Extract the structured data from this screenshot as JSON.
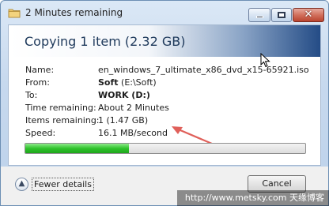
{
  "window": {
    "title": "2 Minutes remaining",
    "controls": {
      "close_label": "✕"
    }
  },
  "dialog": {
    "heading": "Copying 1 item (2.32 GB)",
    "details": [
      {
        "label": "Name:",
        "value": "en_windows_7_ultimate_x86_dvd_x15-65921.iso",
        "bold_part": ""
      },
      {
        "label": "From:",
        "value": "(E:\\Soft)",
        "bold_part": "Soft"
      },
      {
        "label": "To:",
        "value": "",
        "bold_part": "WORK (D:)"
      },
      {
        "label": "Time remaining:",
        "value": "About 2 Minutes",
        "bold_part": ""
      },
      {
        "label": "Items remaining:",
        "value": "1 (1.47 GB)",
        "bold_part": ""
      },
      {
        "label": "Speed:",
        "value": "16.1 MB/second",
        "bold_part": ""
      }
    ],
    "progress_fraction": 0.37
  },
  "footer": {
    "fewer_details_label": "Fewer details",
    "cancel_label": "Cancel"
  },
  "watermark": {
    "text": "http://www.metsky.com 天缘博客"
  },
  "colors": {
    "progress_green": "#2fc42c",
    "arrow_red": "#e0605a",
    "header_blue": "#244c86"
  }
}
